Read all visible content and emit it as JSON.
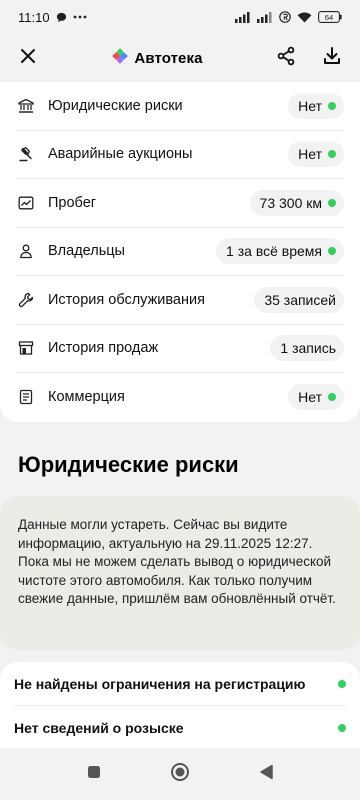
{
  "status": {
    "time": "11:10",
    "battery": "64"
  },
  "header": {
    "app_name": "Автотека"
  },
  "summary": [
    {
      "icon": "bank-icon",
      "label": "Юридические риски",
      "value": "Нет",
      "dot": true
    },
    {
      "icon": "gavel-icon",
      "label": "Аварийные аукционы",
      "value": "Нет",
      "dot": true
    },
    {
      "icon": "chart-icon",
      "label": "Пробег",
      "value": "73 300 км",
      "dot": true
    },
    {
      "icon": "person-icon",
      "label": "Владельцы",
      "value": "1 за всё время",
      "dot": true
    },
    {
      "icon": "wrench-icon",
      "label": "История обслуживания",
      "value": "35 записей",
      "dot": false
    },
    {
      "icon": "storefront-icon",
      "label": "История продаж",
      "value": "1 запись",
      "dot": false
    },
    {
      "icon": "document-icon",
      "label": "Коммерция",
      "value": "Нет",
      "dot": true
    }
  ],
  "section": {
    "title": "Юридические риски"
  },
  "notice": {
    "text": "Данные могли устареть. Сейчас вы видите информацию, актуальную на 29.11.2025 12:27. Пока мы не можем сделать вывод о юридической чистоте этого автомобиля. Как только получим свежие данные, пришлём вам обновлённый отчёт."
  },
  "results": [
    {
      "label": "Не найдены ограничения на регистрацию",
      "dot": true
    },
    {
      "label": "Нет сведений о розыске",
      "dot": true
    }
  ],
  "colors": {
    "ok": "#2fd35b",
    "notice_bg": "#ecebe6"
  }
}
